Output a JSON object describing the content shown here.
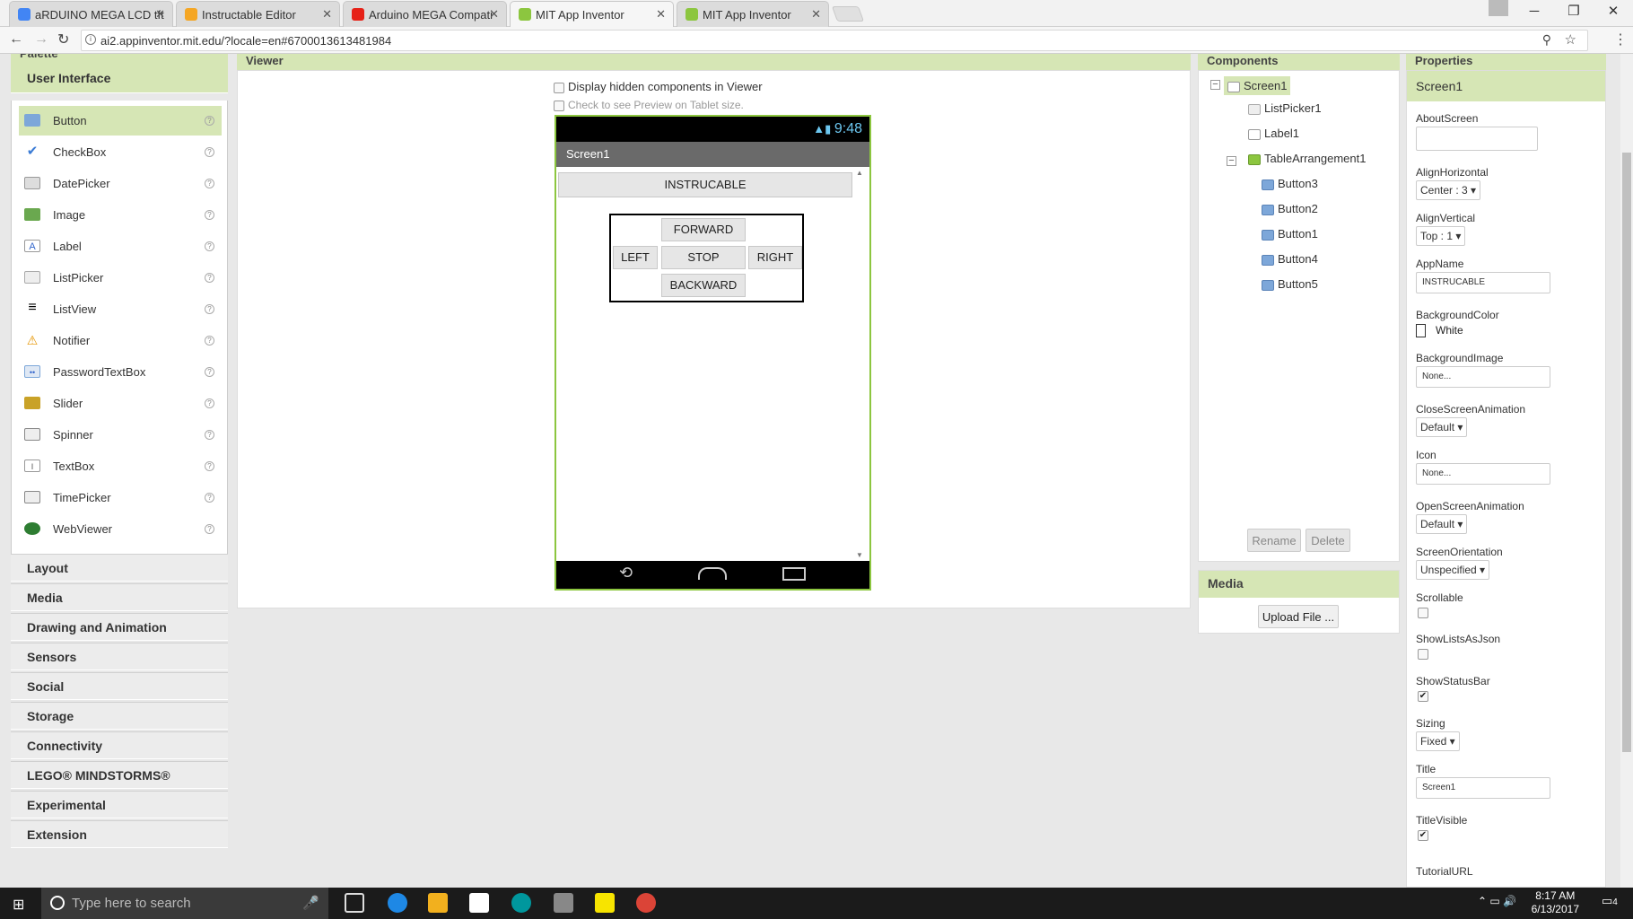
{
  "browser": {
    "tabs": [
      {
        "title": "aRDUINO MEGA LCD tft",
        "color": "#4285f4",
        "active": false
      },
      {
        "title": "Instructable Editor",
        "color": "#f5a623",
        "active": false
      },
      {
        "title": "Arduino MEGA Compati",
        "color": "#e62117",
        "active": false
      },
      {
        "title": "MIT App Inventor",
        "color": "#8cc63f",
        "active": true
      },
      {
        "title": "MIT App Inventor",
        "color": "#8cc63f",
        "active": false
      }
    ],
    "url": "ai2.appinventor.mit.edu/?locale=en#6700013613481984"
  },
  "palette": {
    "header": "Palette",
    "ui_category": "User Interface",
    "items": [
      "Button",
      "CheckBox",
      "DatePicker",
      "Image",
      "Label",
      "ListPicker",
      "ListView",
      "Notifier",
      "PasswordTextBox",
      "Slider",
      "Spinner",
      "TextBox",
      "TimePicker",
      "WebViewer"
    ],
    "categories": [
      "Layout",
      "Media",
      "Drawing and Animation",
      "Sensors",
      "Social",
      "Storage",
      "Connectivity",
      "LEGO® MINDSTORMS®",
      "Experimental",
      "Extension"
    ]
  },
  "viewer": {
    "header": "Viewer",
    "display_hidden": "Display hidden components in Viewer",
    "tablet_preview": "Check to see Preview on Tablet size.",
    "phone": {
      "time": "9:48",
      "title": "Screen1",
      "label": "INSTRUCABLE",
      "buttons": {
        "forward": "FORWARD",
        "left": "LEFT",
        "stop": "STOP",
        "right": "RIGHT",
        "backward": "BACKWARD"
      }
    }
  },
  "components": {
    "header": "Components",
    "tree": [
      {
        "name": "Screen1",
        "icon": "screen-icon"
      },
      {
        "name": "ListPicker1",
        "icon": "listpicker-icon"
      },
      {
        "name": "Label1",
        "icon": "label-icon"
      },
      {
        "name": "TableArrangement1",
        "icon": "table-icon"
      },
      {
        "name": "Button3",
        "icon": "button-icon"
      },
      {
        "name": "Button2",
        "icon": "button-icon"
      },
      {
        "name": "Button1",
        "icon": "button-icon"
      },
      {
        "name": "Button4",
        "icon": "button-icon"
      },
      {
        "name": "Button5",
        "icon": "button-icon"
      }
    ],
    "rename": "Rename",
    "delete": "Delete"
  },
  "media": {
    "header": "Media",
    "upload": "Upload File ..."
  },
  "properties": {
    "header": "Properties",
    "component": "Screen1",
    "about_label": "AboutScreen",
    "align_h_label": "AlignHorizontal",
    "align_h_value": "Center : 3",
    "align_v_label": "AlignVertical",
    "align_v_value": "Top : 1",
    "appname_label": "AppName",
    "appname_value": "INSTRUCABLE",
    "bgcolor_label": "BackgroundColor",
    "bgcolor_value": "White",
    "bgimage_label": "BackgroundImage",
    "bgimage_value": "None...",
    "close_anim_label": "CloseScreenAnimation",
    "close_anim_value": "Default",
    "icon_label": "Icon",
    "icon_value": "None...",
    "open_anim_label": "OpenScreenAnimation",
    "open_anim_value": "Default",
    "orientation_label": "ScreenOrientation",
    "orientation_value": "Unspecified",
    "scrollable_label": "Scrollable",
    "lists_json_label": "ShowListsAsJson",
    "statusbar_label": "ShowStatusBar",
    "sizing_label": "Sizing",
    "sizing_value": "Fixed",
    "title_label": "Title",
    "title_value": "Screen1",
    "title_visible_label": "TitleVisible",
    "tutorial_label": "TutorialURL"
  },
  "taskbar": {
    "search_placeholder": "Type here to search",
    "time": "8:17 AM",
    "date": "6/13/2017",
    "notifications": "4"
  }
}
